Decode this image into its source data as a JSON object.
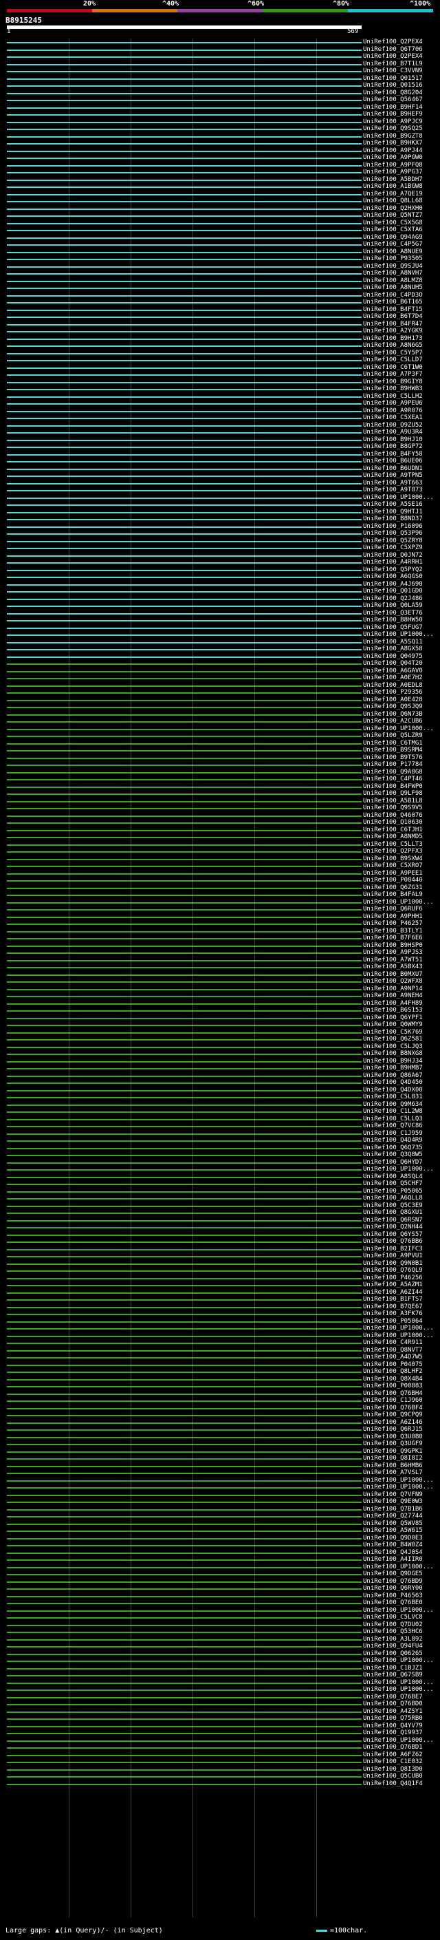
{
  "legend": {
    "ticks": [
      "20%",
      "^40%",
      "^60%",
      "^80%",
      "^100%"
    ],
    "colors": [
      "#d0001c",
      "#e07000",
      "#9a3db0",
      "#1fa700",
      "#1ec0d8"
    ]
  },
  "query": {
    "id": "B8915245",
    "start_label": "1",
    "end_label": "569"
  },
  "hits": [
    "UniRef100_Q2PEX4",
    "UniRef100_Q6T706",
    "UniRef100_Q2PEX4",
    "UniRef100_B7T1L9",
    "UniRef100_C3VVN9",
    "UniRef100_Q01517",
    "UniRef100_Q01516",
    "UniRef100_Q8G204",
    "UniRef100_Q56467",
    "UniRef100_B9HF14",
    "UniRef100_B9HEF9",
    "UniRef100_A9PJC9",
    "UniRef100_Q9SQ25",
    "UniRef100_B9GZT8",
    "UniRef100_B9HKX7",
    "UniRef100_A9PJ44",
    "UniRef100_A9PGW0",
    "UniRef100_A9PFQ8",
    "UniRef100_A9PG37",
    "UniRef100_A5BDH7",
    "UniRef100_A1BGW8",
    "UniRef100_A7QE19",
    "UniRef100_Q8LL68",
    "UniRef100_Q2HXH0",
    "UniRef100_Q5NTZ7",
    "UniRef100_C5X5G8",
    "UniRef100_C5XTA6",
    "UniRef100_Q94AG9",
    "UniRef100_C4P5G7",
    "UniRef100_A8NUE9",
    "UniRef100_P93505",
    "UniRef100_Q9SJU4",
    "UniRef100_A8NVH7",
    "UniRef100_A8LMZ8",
    "UniRef100_A8NUH5",
    "UniRef100_C4PD3O",
    "UniRef100_B6T165",
    "UniRef100_B4FT15",
    "UniRef100_B6T7D4",
    "UniRef100_B4FR47",
    "UniRef100_A2YGK9",
    "UniRef100_B9H173",
    "UniRef100_A8N6G5",
    "UniRef100_C5Y5P7",
    "UniRef100_C5LLD7",
    "UniRef100_C6T1W0",
    "UniRef100_A7P3F7",
    "UniRef100_B9GIY8",
    "UniRef100_B9HWB3",
    "UniRef100_C5LLH2",
    "UniRef100_A9PEU6",
    "UniRef100_A9R076",
    "UniRef100_C5XEA1",
    "UniRef100_Q9ZU52",
    "UniRef100_A9U3R4",
    "UniRef100_B9HJ10",
    "UniRef100_B8GP72",
    "UniRef100_B4FY58",
    "UniRef100_B6UE06",
    "UniRef100_B6UDN1",
    "UniRef100_A9TPN5",
    "UniRef100_A9T663",
    "UniRef100_A9T873",
    "UniRef100_UP1000...",
    "UniRef100_A5SE16",
    "UniRef100_Q9HTJ1",
    "UniRef100_B8ND37",
    "UniRef100_P16096",
    "UniRef100_Q53P96",
    "UniRef100_Q5ZRY8",
    "UniRef100_C5XPZ9",
    "UniRef100_Q0JN72",
    "UniRef100_A4RRH1",
    "UniRef100_Q5PYQ2",
    "UniRef100_A6QGS0",
    "UniRef100_A4J690",
    "UniRef100_Q01GD0",
    "UniRef100_Q2J486",
    "UniRef100_Q0LA59",
    "UniRef100_Q3ET76",
    "UniRef100_B8HW50",
    "UniRef100_Q5FUG7",
    "UniRef100_UP1000...",
    "UniRef100_A5SQ11",
    "UniRef100_A8GX58",
    "UniRef100_Q04975",
    "UniRef100_Q04T20",
    "UniRef100_A6GAV0",
    "UniRef100_A0E7H2",
    "UniRef100_A0EDL8",
    "UniRef100_P29356",
    "UniRef100_A0E428",
    "UniRef100_Q9SJQ9",
    "UniRef100_Q6N73B",
    "UniRef100_A2CUB6",
    "UniRef100_UP1000...",
    "UniRef100_Q5LZR9",
    "UniRef100_C6TMG1",
    "UniRef100_B9SRM4",
    "UniRef100_B9T576",
    "UniRef100_P17784",
    "UniRef100_Q9A8G8",
    "UniRef100_C4PT46",
    "UniRef100_B4FWP0",
    "UniRef100_Q9LF98",
    "UniRef100_A5B1L8",
    "UniRef100_Q9S9V5",
    "UniRef100_Q46076",
    "UniRef100_Q10630",
    "UniRef100_C6TJH1",
    "UniRef100_A8NMD5",
    "UniRef100_C5LLT3",
    "UniRef100_Q2PFX3",
    "UniRef100_B9SXW4",
    "UniRef100_C5XRO7",
    "UniRef100_A9PEE1",
    "UniRef100_P08440",
    "UniRef100_Q6ZG31",
    "UniRef100_B4FAL9",
    "UniRef100_UP1000...",
    "UniRef100_Q6RUF6",
    "UniRef100_A9PHH1",
    "UniRef100_P46257",
    "UniRef100_B3TLY1",
    "UniRef100_B7F6E6",
    "UniRef100_B9HSP0",
    "UniRef100_A9PJS3",
    "UniRef100_A7WT51",
    "UniRef100_A5BX43",
    "UniRef100_B0MXU7",
    "UniRef100_Q2WFX8",
    "UniRef100_A9NP14",
    "UniRef100_A9NEH4",
    "UniRef100_A4FH89",
    "UniRef100_B6S153",
    "UniRef100_Q6YPF1",
    "UniRef100_Q0WMY9",
    "UniRef100_C5K769",
    "UniRef100_Q6Z581",
    "UniRef100_C5LJQ3",
    "UniRef100_B8NXG8",
    "UniRef100_B9HJ34",
    "UniRef100_B9HMB7",
    "UniRef100_Q86A67",
    "UniRef100_Q4D450",
    "UniRef100_Q4DX00",
    "UniRef100_C5L831",
    "UniRef100_Q9M634",
    "UniRef100_C1L2W8",
    "UniRef100_C5LLQ3",
    "UniRef100_Q7VC86",
    "UniRef100_C1J959",
    "UniRef100_Q4D4R9",
    "UniRef100_Q6Q735",
    "UniRef100_Q3Q8W5",
    "UniRef100_Q6HYD7",
    "UniRef100_UP1000...",
    "UniRef100_A8SQL4",
    "UniRef100_Q5CHF7",
    "UniRef100_P05065",
    "UniRef100_A6QLL8",
    "UniRef100_Q5C3E9",
    "UniRef100_Q8GXU1",
    "UniRef100_Q6RSN7",
    "UniRef100_Q2NH44",
    "UniRef100_Q6YS57",
    "UniRef100_Q76BB6",
    "UniRef100_B2IFC3",
    "UniRef100_A9PVU1",
    "UniRef100_Q9N0B1",
    "UniRef100_Q76QL9",
    "UniRef100_P46256",
    "UniRef100_A5AZM1",
    "UniRef100_A6ZI44",
    "UniRef100_B1FTS7",
    "UniRef100_B7QE67",
    "UniRef100_A3FK76",
    "UniRef100_P05064",
    "UniRef100_UP1000...",
    "UniRef100_UP1000...",
    "UniRef100_C4R911",
    "UniRef100_Q8NVT7",
    "UniRef100_A4D7W5",
    "UniRef100_P04075",
    "UniRef100_Q8LHF2",
    "UniRef100_Q8X4B4",
    "UniRef100_P00883",
    "UniRef100_Q76BH4",
    "UniRef100_C1J960",
    "UniRef100_Q76BF4",
    "UniRef100_Q9CPQ9",
    "UniRef100_A6Z146",
    "UniRef100_Q6RJ15",
    "UniRef100_Q3U0B0",
    "UniRef100_Q3UGF9",
    "UniRef100_Q9GPK1",
    "UniRef100_Q8I8I2",
    "UniRef100_B6HMB6",
    "UniRef100_A7VSL7",
    "UniRef100_UP1000...",
    "UniRef100_UP1000...",
    "UniRef100_Q7VFN9",
    "UniRef100_Q9E0W3",
    "UniRef100_Q7B1B6",
    "UniRef100_Q27744",
    "UniRef100_Q5WV85",
    "UniRef100_A5W615",
    "UniRef100_Q9D0E3",
    "UniRef100_B4W0Z4",
    "UniRef100_Q4J0S4",
    "UniRef100_A4IIR0",
    "UniRef100_UP1000...",
    "UniRef100_Q9DGE5",
    "UniRef100_Q76BD9",
    "UniRef100_Q6RY00",
    "UniRef100_P46563",
    "UniRef100_Q76BE0",
    "UniRef100_UP1000...",
    "UniRef100_C5LVC8",
    "UniRef100_Q7DU02",
    "UniRef100_Q53HC6",
    "UniRef100_A3L892",
    "UniRef100_Q94FU4",
    "UniRef100_Q06265",
    "UniRef100_UP1000...",
    "UniRef100_C1BJZ1",
    "UniRef100_Q67SB9",
    "UniRef100_UP1000...",
    "UniRef100_UP1000...",
    "UniRef100_Q76BE7",
    "UniRef100_Q76BD0",
    "UniRef100_A4ZSY1",
    "UniRef100_Q75RB0",
    "UniRef100_Q4YV79",
    "UniRef100_Q19937",
    "UniRef100_UP1000...",
    "UniRef100_Q76BD1",
    "UniRef100_A6FZ62",
    "UniRef100_C1E032",
    "UniRef100_Q8I3D0",
    "UniRef100_Q5CUB0",
    "UniRef100_Q4Q1F4"
  ],
  "footer": {
    "gaps_label": "Large gaps: ▲(in Query)/- (in Subject)",
    "scale_label": "=100char."
  },
  "colors": {
    "cyan": "#5ad7d7",
    "green": "#3fa71f",
    "gridline": "#ffffff"
  }
}
